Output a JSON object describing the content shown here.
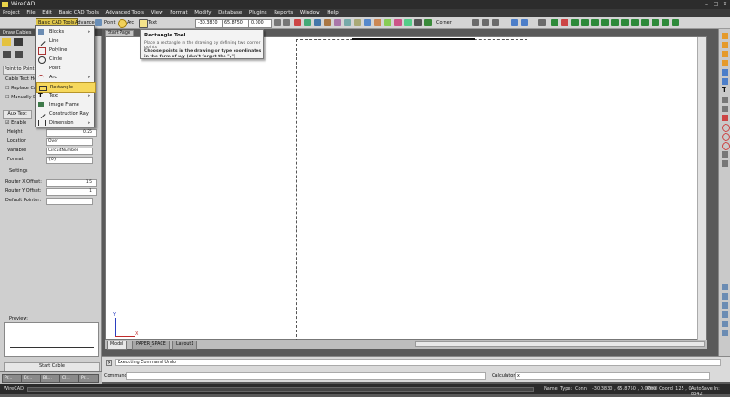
{
  "app": {
    "title": "WireCAD"
  },
  "menubar": {
    "items": [
      "Project",
      "File",
      "Edit",
      "Basic CAD Tools",
      "Advanced Tools",
      "View",
      "Format",
      "Modify",
      "Database",
      "Plugins",
      "Reports",
      "Window",
      "Help"
    ]
  },
  "toolbar": {
    "basic_cad_tab": "Basic CAD Tools",
    "advanced_tab": "Advanced",
    "point_label": "Point",
    "arc_label": "Arc",
    "text_label": "Text",
    "coord_x": "-30.3830",
    "coord_y": "65.8750",
    "coord_z": "0.000",
    "corner_label": "Corner"
  },
  "dropdown": {
    "items": [
      {
        "label": "Blocks",
        "submenu": true
      },
      {
        "label": "Line",
        "submenu": false
      },
      {
        "label": "Polyline",
        "submenu": false
      },
      {
        "label": "Circle",
        "submenu": false
      },
      {
        "label": "Point",
        "submenu": false
      },
      {
        "label": "Arc",
        "submenu": true
      },
      {
        "label": "Rectangle",
        "submenu": false
      },
      {
        "label": "Text",
        "submenu": true
      },
      {
        "label": "Image Frame",
        "submenu": false
      },
      {
        "label": "Construction Ray",
        "submenu": false
      },
      {
        "label": "Dimension",
        "submenu": true
      }
    ],
    "arrow": "▸"
  },
  "tooltip": {
    "title": "Rectangle Tool",
    "description": "Place a rectangle in the drawing by defining two corner points",
    "hint": "Choose points in the drawing or type coordinates in the form of x,y (don't forget the \",\")"
  },
  "left_panel": {
    "header": "Draw Cables",
    "point_to_point": "Point to Point",
    "cable_text_label": "Cable Text Hel",
    "replace_cable": "Replace Cab",
    "manually_draw": "Manually Dr",
    "aux_text_tab": "Aux Text",
    "enable_label": "Enable",
    "fields": [
      {
        "label": "Height",
        "value": "0.25"
      },
      {
        "label": "Location",
        "value": "Over"
      },
      {
        "label": "Variable",
        "value": "CircuitNumber"
      },
      {
        "label": "Format",
        "value": "{0}"
      }
    ],
    "settings_label": "Settings",
    "router_x_label": "Router X Offset:",
    "router_x_value": "1.5",
    "router_y_label": "Router Y Offset:",
    "router_y_value": "1",
    "default_pointer_label": "Default Pointer:",
    "preview_label": "Preview:",
    "start_cable": "Start Cable"
  },
  "canvas": {
    "start_page_tab": "Start Page"
  },
  "bottom_tabs": [
    {
      "label": "Model"
    },
    {
      "label": "PAPER_SPACE"
    },
    {
      "label": "Layout1"
    }
  ],
  "command": {
    "output": "Executing Command Undo",
    "command_label": "Command:",
    "calculator_label": "Calculator:",
    "calculator_value": "x"
  },
  "status": {
    "app_name": "WireCAD",
    "name_label": "Name:",
    "type_label": "Type:",
    "type_value": "Conn",
    "coords": "-30.3830 , 65.8750 , 0.0000",
    "pixel_coord": "Pixel Coord: 125 , 0",
    "autosave": "AutoSave In: 8342"
  },
  "taskbar": {
    "items": [
      "Pr...",
      "Dr...",
      "BL...",
      "Cl...",
      "Pr..."
    ]
  },
  "window_controls": {
    "minimize": "–",
    "maximize": "□",
    "close": "✕"
  },
  "colors": {
    "highlight": "#f6d85c",
    "titlebar": "#2c2c2c",
    "accent": "#e0c64a"
  }
}
